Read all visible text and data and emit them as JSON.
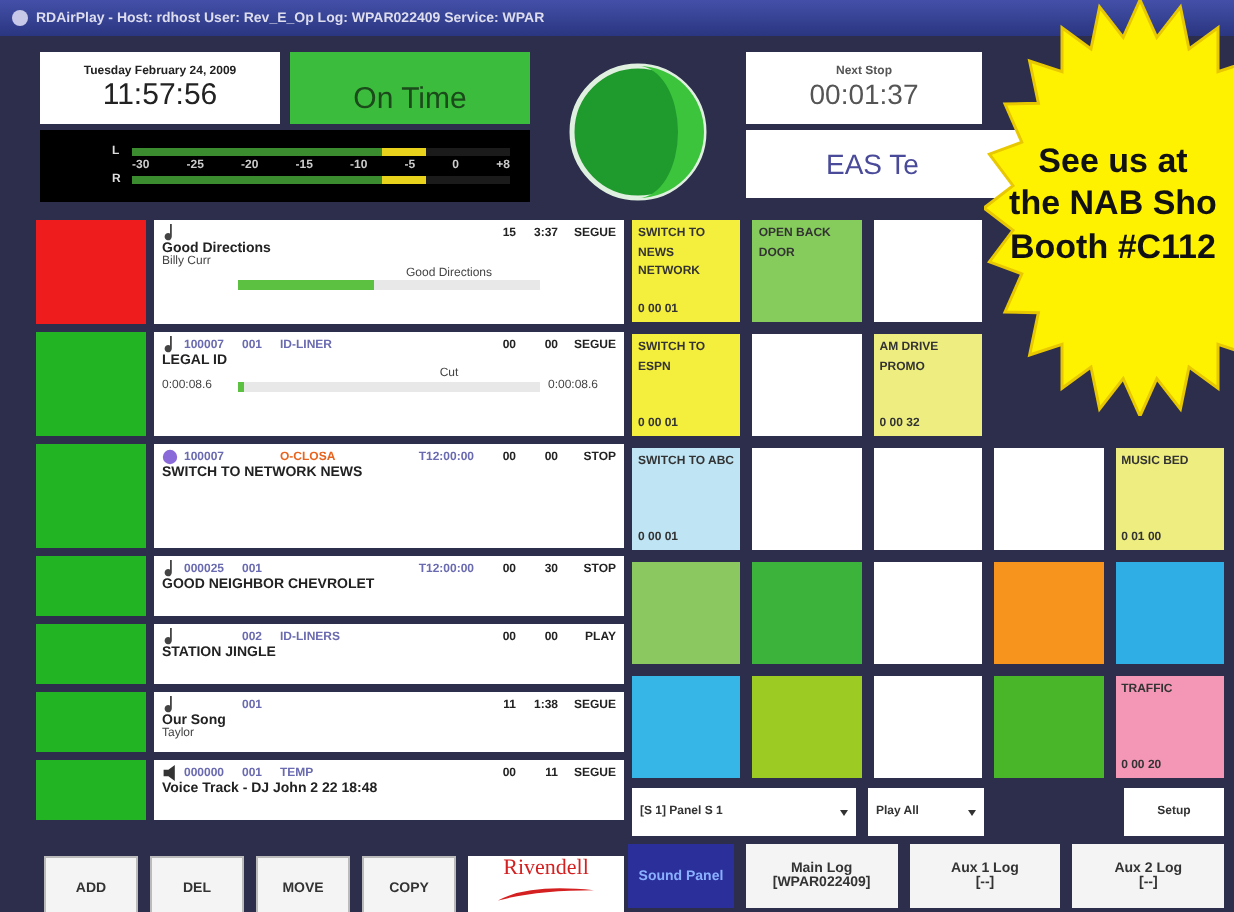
{
  "window": {
    "title": "RDAirPlay - Host: rdhost User: Rev_E_Op Log: WPAR022409 Service: WPAR"
  },
  "clock": {
    "date": "Tuesday February 24, 2009",
    "time": "11:57:56"
  },
  "timing": {
    "status": "On Time"
  },
  "meter": {
    "channels": [
      {
        "label": "L",
        "level": 0.78
      },
      {
        "label": "R",
        "level": 0.78
      }
    ],
    "scale": [
      "-30",
      "-25",
      "-20",
      "-15",
      "-10",
      "-5",
      "0",
      "+8"
    ]
  },
  "next_stop": {
    "label": "Next Stop",
    "time": "00:01:37"
  },
  "message": "EAS Te",
  "promo": {
    "lines": [
      "See us at",
      "the NAB Sho",
      "Booth #C112"
    ]
  },
  "log": [
    {
      "kind": "audio",
      "color": "#ee1c1c",
      "talk": "15",
      "length": "3:37",
      "transition": "SEGUE",
      "title": "Good Directions",
      "artist": "Billy Curr",
      "progress": {
        "label": "Good Directions",
        "level": 0.45
      }
    },
    {
      "kind": "audio",
      "color": "#22b422",
      "cart": "100007",
      "cut": "001",
      "group": {
        "name": "ID-LINER",
        "color": "#6a6ab0"
      },
      "talk": "00",
      "length": "00",
      "transition": "SEGUE",
      "title": "LEGAL ID",
      "progress": {
        "label": "Cut",
        "level": 0.02,
        "start": "0:00:08.6",
        "end": "0:00:08.6"
      }
    },
    {
      "kind": "macro",
      "color": "#22b422",
      "cart": "100007",
      "group": {
        "name": "O-CLOSA",
        "color": "#e8641e"
      },
      "scheduled": "T12:00:00",
      "talk": "00",
      "length": "00",
      "transition": "STOP",
      "title": "SWITCH TO NETWORK NEWS"
    },
    {
      "kind": "audio",
      "color": "#22b422",
      "cart": "000025",
      "cut": "001",
      "scheduled": "T12:00:00",
      "talk": "00",
      "length": "30",
      "transition": "STOP",
      "title": "GOOD NEIGHBOR CHEVROLET"
    },
    {
      "kind": "audio",
      "color": "#22b422",
      "cut": "002",
      "group": {
        "name": "ID-LINERS",
        "color": "#6a6ab0"
      },
      "talk": "00",
      "length": "00",
      "transition": "PLAY",
      "title": "STATION JINGLE"
    },
    {
      "kind": "audio",
      "color": "#22b422",
      "cut": "001",
      "talk": "11",
      "length": "1:38",
      "transition": "SEGUE",
      "title": "Our Song",
      "artist": "Taylor"
    },
    {
      "kind": "marker",
      "color": "#22b422",
      "cart": "000000",
      "cut": "001",
      "group": {
        "name": "TEMP",
        "color": "#6a6ab0"
      },
      "talk": "00",
      "length": "11",
      "transition": "SEGUE",
      "title": "Voice Track - DJ John 2 22 18:48"
    }
  ],
  "log_buttons": [
    "ADD",
    "DEL",
    "MOVE",
    "COPY"
  ],
  "logo": {
    "name": "Rivendell"
  },
  "panel": {
    "rows": [
      [
        {
          "kind": "cart",
          "color": "#f4ee3c",
          "label": "SWITCH TO NEWS NETWORK",
          "length": "0 00 01"
        },
        {
          "kind": "cart",
          "color": "#86cc5c",
          "label": "OPEN BACK DOOR"
        },
        {
          "kind": "blank"
        },
        {
          "kind": "covered"
        },
        {
          "kind": "covered"
        }
      ],
      [
        {
          "kind": "cart",
          "color": "#f4ee3c",
          "label": "SWITCH TO ESPN",
          "length": "0 00 01"
        },
        {
          "kind": "blank"
        },
        {
          "kind": "cart",
          "color": "#eeee80",
          "label": "AM DRIVE PROMO",
          "length": "0 00 32"
        },
        {
          "kind": "covered"
        },
        {
          "kind": "covered"
        }
      ],
      [
        {
          "kind": "cart",
          "color": "#bfe4f4",
          "label": "SWITCH TO ABC",
          "length": "0 00 01"
        },
        {
          "kind": "blank"
        },
        {
          "kind": "blank"
        },
        {
          "kind": "blank"
        },
        {
          "kind": "cart",
          "color": "#eeee80",
          "label": "MUSIC BED",
          "length": "0 01 00"
        }
      ],
      [
        {
          "kind": "cart",
          "color": "#8cc860"
        },
        {
          "kind": "cart",
          "color": "#3cb43c"
        },
        {
          "kind": "blank"
        },
        {
          "kind": "cart",
          "color": "#f7941d"
        },
        {
          "kind": "cart",
          "color": "#2eaee4"
        }
      ],
      [
        {
          "kind": "cart",
          "color": "#36b6e6"
        },
        {
          "kind": "cart",
          "color": "#9ccc24"
        },
        {
          "kind": "blank"
        },
        {
          "kind": "cart",
          "color": "#48b628"
        },
        {
          "kind": "cart",
          "color": "#f497b6",
          "label": "TRAFFIC",
          "length": "0 00 20"
        }
      ]
    ],
    "selector": "[S 1] Panel S 1",
    "mode": "Play All",
    "setup": "Setup"
  },
  "tabs": [
    {
      "label": "Sound Panel",
      "selected": true
    },
    {
      "label": "Main Log",
      "sublabel": "[WPAR022409]",
      "selected": false
    },
    {
      "label": "Aux 1 Log",
      "sublabel": "[--]",
      "selected": false
    },
    {
      "label": "Aux 2 Log",
      "sublabel": "[--]",
      "selected": false
    }
  ]
}
